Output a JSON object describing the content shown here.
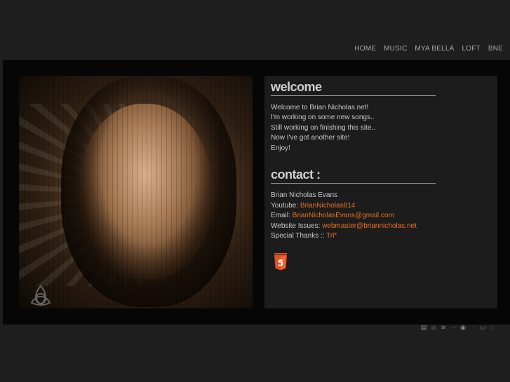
{
  "nav": {
    "items": [
      "HOME",
      "MUSIC",
      "MYA BELLA",
      "LOFT",
      "BNE"
    ]
  },
  "welcome": {
    "heading": "welcome",
    "lines": [
      "Welcome to Brian Nicholas.net!",
      "I'm working on some new songs..",
      "Still working on finishing this site..",
      "Now I've got another site!",
      "Enjoy!"
    ]
  },
  "contact": {
    "heading": "contact :",
    "name": "Brian Nicholas Evans",
    "youtube_label": "Youtube: ",
    "youtube_link": "BrianNicholas814",
    "email_label": "Email: ",
    "email_link": "BrianNicholasEvans@gmail.com",
    "issues_label": "Website Issues: ",
    "issues_link": "webmaster@briannicholas.net",
    "thanks_label": "Special Thanks :: ",
    "thanks_link": "Tri*"
  },
  "badges": {
    "html5_icon": "html5-logo-icon",
    "html5_text": "5"
  },
  "footer_icons": [
    "css3-icon",
    "circle-icon",
    "layers-icon",
    "arrow-icon",
    "target-icon",
    "chevron-left-icon",
    "window-icon",
    "circle-outline-icon"
  ],
  "colors": {
    "link": "#e8721f",
    "panel_bg": "#1c1c1c",
    "page_bg": "#1e1e1e"
  }
}
